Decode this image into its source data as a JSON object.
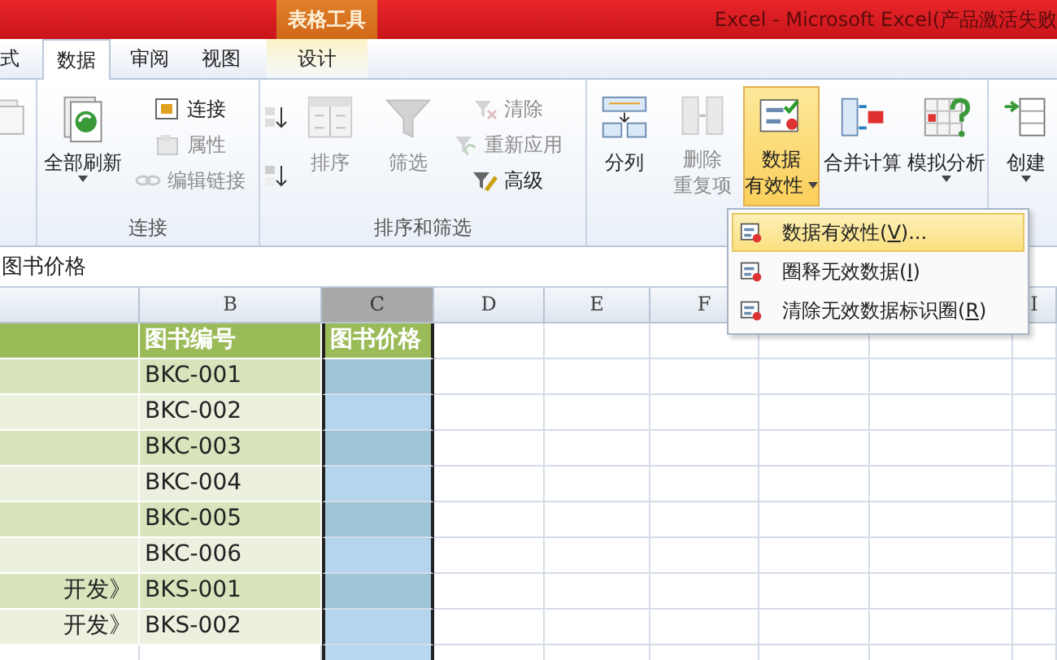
{
  "title_bar": {
    "context_group": "表格工具",
    "title": "Excel - Microsoft Excel(产品激活失败"
  },
  "tabs": [
    {
      "label": "式",
      "selected": false,
      "kind": "normal"
    },
    {
      "label": "数据",
      "selected": true,
      "kind": "normal"
    },
    {
      "label": "审阅",
      "selected": false,
      "kind": "normal"
    },
    {
      "label": "视图",
      "selected": false,
      "kind": "normal"
    },
    {
      "label": "设计",
      "selected": false,
      "kind": "contextual"
    }
  ],
  "ribbon": {
    "groups": [
      {
        "items": [
          {
            "kind": "large",
            "disabled": true,
            "dropdown": false,
            "highlighted": false
          }
        ]
      },
      {
        "label": "连接",
        "items": [
          {
            "kind": "large",
            "lines": [
              "全部刷新"
            ],
            "disabled": false,
            "dropdown": true,
            "highlighted": false
          },
          {
            "kind": "small",
            "lines": [
              "连接"
            ],
            "disabled": false,
            "dropdown": false,
            "highlighted": false
          },
          {
            "kind": "small",
            "lines": [
              "属性"
            ],
            "disabled": true,
            "dropdown": false,
            "highlighted": false
          },
          {
            "kind": "small",
            "lines": [
              "编辑链接"
            ],
            "disabled": true,
            "dropdown": false,
            "highlighted": false
          }
        ]
      },
      {
        "label": "排序和筛选",
        "items": [
          {
            "kind": "icon_only",
            "disabled": false,
            "dropdown": false,
            "highlighted": false
          },
          {
            "kind": "icon_only",
            "disabled": false,
            "dropdown": false,
            "highlighted": false
          },
          {
            "kind": "large",
            "lines": [
              "排序"
            ],
            "disabled": true,
            "dropdown": false,
            "highlighted": false
          },
          {
            "kind": "large",
            "lines": [
              "筛选"
            ],
            "disabled": true,
            "dropdown": false,
            "highlighted": false
          },
          {
            "kind": "small",
            "lines": [
              "清除"
            ],
            "disabled": true,
            "dropdown": false,
            "highlighted": false
          },
          {
            "kind": "small",
            "lines": [
              "重新应用"
            ],
            "disabled": true,
            "dropdown": false,
            "highlighted": false
          },
          {
            "kind": "small",
            "lines": [
              "高级"
            ],
            "disabled": false,
            "dropdown": false,
            "highlighted": false
          }
        ]
      },
      {
        "items": [
          {
            "kind": "large",
            "lines": [
              "分列"
            ],
            "disabled": false,
            "dropdown": false,
            "highlighted": false
          },
          {
            "kind": "large",
            "lines": [
              "删除",
              "重复项"
            ],
            "disabled": true,
            "dropdown": false,
            "highlighted": false
          },
          {
            "kind": "large",
            "lines": [
              "数据",
              "有效性"
            ],
            "disabled": false,
            "dropdown": true,
            "highlighted": true
          },
          {
            "kind": "large",
            "lines": [
              "合并计算"
            ],
            "disabled": false,
            "dropdown": false,
            "highlighted": false
          },
          {
            "kind": "large",
            "lines": [
              "模拟分析"
            ],
            "disabled": false,
            "dropdown": true,
            "highlighted": false
          }
        ]
      },
      {
        "items": [
          {
            "kind": "large",
            "lines": [
              "创建"
            ],
            "disabled": false,
            "dropdown": true,
            "highlighted": false
          }
        ]
      }
    ]
  },
  "formula_bar": {
    "value": "图书价格"
  },
  "sheet": {
    "columns": [
      {
        "selected": false
      },
      {
        "letter": "B",
        "selected": false
      },
      {
        "letter": "C",
        "selected": true
      },
      {
        "letter": "D",
        "selected": false
      },
      {
        "letter": "E",
        "selected": false
      },
      {
        "letter": "F",
        "selected": false
      },
      {
        "letter": "I",
        "selected": false
      }
    ],
    "header_row": {
      "book_id": "图书编号",
      "price": "图书价格"
    },
    "rows": [
      {
        "book_id": "BKC-001"
      },
      {
        "book_id": "BKC-002"
      },
      {
        "book_id": "BKC-003"
      },
      {
        "book_id": "BKC-004"
      },
      {
        "book_id": "BKC-005"
      },
      {
        "book_id": "BKC-006"
      },
      {
        "book_name": "开发》",
        "book_id": "BKS-001"
      },
      {
        "book_name": "开发》",
        "book_id": "BKS-002"
      }
    ]
  },
  "menu": {
    "items": [
      {
        "before": "数据有效性(",
        "key": "V",
        "after": ")...",
        "selected": true
      },
      {
        "before": "圈释无效数据(",
        "key": "I",
        "after": ")",
        "selected": false
      },
      {
        "before": "清除无效数据标识圈(",
        "key": "R",
        "after": ")",
        "selected": false
      }
    ]
  }
}
